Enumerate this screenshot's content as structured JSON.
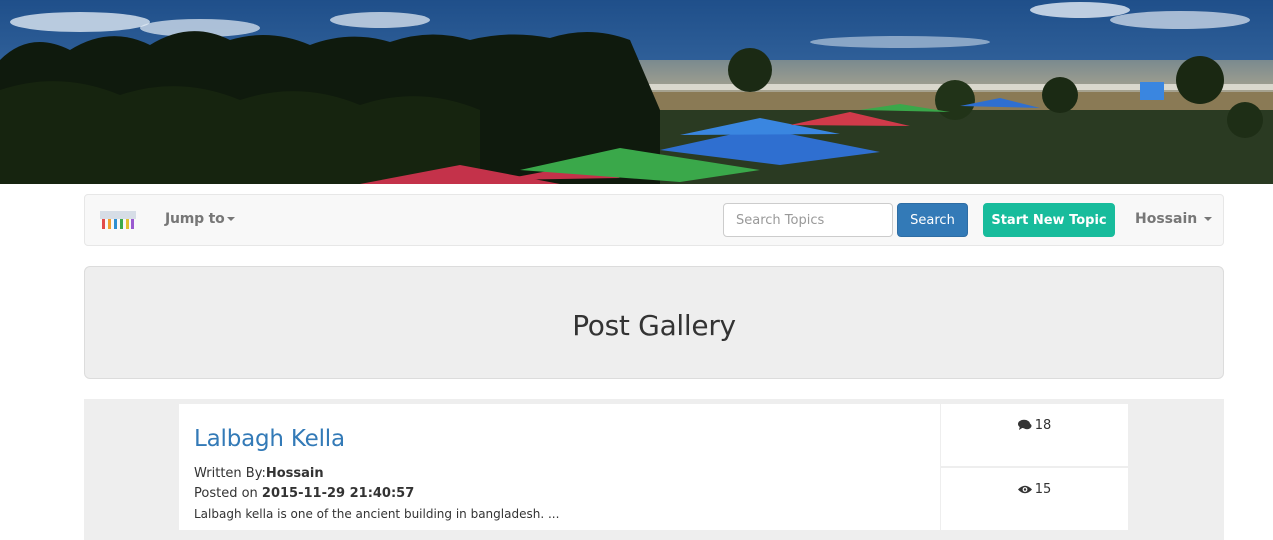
{
  "banner": {
    "alt": "beach-banner"
  },
  "navbar": {
    "jump_label": "Jump to",
    "search_placeholder": "Search Topics",
    "search_label": "Search",
    "new_topic_label": "Start New Topic",
    "user_label": "Hossain"
  },
  "main": {
    "title": "Post Gallery"
  },
  "post": {
    "title": "Lalbagh Kella",
    "written_by_prefix": "Written By:",
    "author": "Hossain",
    "posted_on_prefix": "Posted on ",
    "date": "2015-11-29 21:40:57",
    "excerpt": "Lalbagh kella is one of the ancient building in bangladesh. ...",
    "comments_count": "18",
    "views_count": "15"
  },
  "icons": {
    "comments": "comments-icon",
    "views": "eye-icon",
    "logo": "site-logo"
  },
  "colors": {
    "primary": "#337ab7",
    "success": "#18bc9c",
    "link": "#337ab7"
  }
}
